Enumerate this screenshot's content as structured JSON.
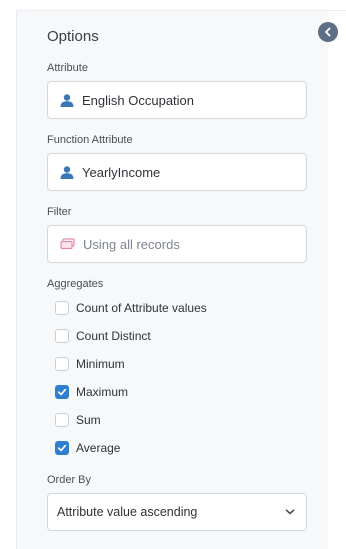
{
  "panel": {
    "title": "Options",
    "attribute": {
      "label": "Attribute",
      "value": "English Occupation"
    },
    "function_attribute": {
      "label": "Function Attribute",
      "value": "YearlyIncome"
    },
    "filter": {
      "label": "Filter",
      "value": "Using all records"
    },
    "aggregates": {
      "label": "Aggregates",
      "items": [
        {
          "label": "Count of Attribute values",
          "checked": false
        },
        {
          "label": "Count Distinct",
          "checked": false
        },
        {
          "label": "Minimum",
          "checked": false
        },
        {
          "label": "Maximum",
          "checked": true
        },
        {
          "label": "Sum",
          "checked": false
        },
        {
          "label": "Average",
          "checked": true
        }
      ]
    },
    "order_by": {
      "label": "Order By",
      "value": "Attribute value ascending"
    }
  },
  "colors": {
    "accent": "#2f7fd0",
    "icon_blue": "#3a78b5",
    "filter_icon": "#e58aa8",
    "collapse_button": "#5d6f84"
  }
}
